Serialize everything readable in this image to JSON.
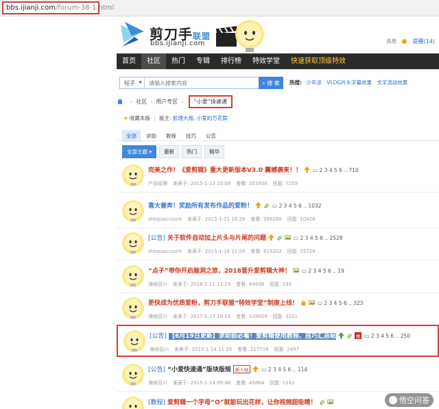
{
  "address_bar": {
    "host": "bbs.ijianji.com",
    "path": "/forum-38-1.html"
  },
  "logo": {
    "name": "剪刀手",
    "alliance": "联盟",
    "domain": "bbs.iJianJi.com"
  },
  "top_right": {
    "messages": "消息",
    "reminder": "提醒(14)"
  },
  "nav": {
    "items": [
      "首页",
      "社区",
      "热门",
      "专辑",
      "排行榜",
      "特效学堂"
    ],
    "active": "社区",
    "promo": "快速获取顶级特效"
  },
  "search": {
    "type_value": "帖子",
    "placeholder": "请输入搜索内容",
    "button": "搜 索",
    "hot_label": "热搜:",
    "hot_words": [
      "少年派",
      "VLOG片头字幕效果",
      "文字流动效果"
    ]
  },
  "breadcrumb": [
    "社区",
    "用户专区"
  ],
  "breadcrumb_current": "“小爱”快速通",
  "collect": {
    "label": "收藏本版",
    "moderator_label": "版主:",
    "moderators": "肌理大炮, 小爱的万花筒"
  },
  "tabs_primary": [
    "全部",
    "求助",
    "教程",
    "技巧",
    "公告"
  ],
  "tabs_secondary": [
    "全部主题",
    "最新",
    "热门",
    "精华"
  ],
  "threads": [
    {
      "tag": "",
      "title": "完美之作！《爱剪辑》重大更新版本V3.0 震撼袭来！！",
      "color": "#d03a1e",
      "pages": "2 3 4 5 6 .. 710",
      "author": "产品经理",
      "date": "发表于: 2015-1-13 15:09",
      "views": "查看: 351000",
      "replies": "回复: 7259"
    },
    {
      "tag": "",
      "title": "喜大普奔！奖励所有发布作品的爱粉！",
      "color": "#3b7ad1",
      "pages": "2 3 4 5 6 .. 1032",
      "author": "shequaccount",
      "date": "发表于: 2015-1-21 18:28",
      "views": "查看: 399280",
      "replies": "回复: 10428"
    },
    {
      "tag": "[公告]",
      "title": "关于软件自动加上片头与片尾的问题",
      "color": "#d03a1e",
      "pages": "2 3 4 5 6 .. 2528",
      "author": "shequaccount",
      "date": "发表于: 2015-1-18 21:54",
      "views": "查看: 819202",
      "replies": "回复: 25728"
    },
    {
      "tag": "",
      "title": "“点子”带你开启脑洞之旅，2018晋升爱剪辑大神！",
      "color": "#d03a1e",
      "pages": "2 3 4 5 6 .. 19",
      "author": "海纳百川",
      "date": "发表于: 2018-2-11 13:29",
      "views": "查看: 44938",
      "replies": "回复: 193"
    },
    {
      "tag": "",
      "title": "更快成为优质爱粉，剪刀手联盟“特效学堂”制度上线！",
      "color": "#d03a1e",
      "pages": "2 3 4 5 6 .. 323",
      "author": "海纳百川",
      "date": "发表于: 2017-5-17 16:15",
      "views": "查看: 109459",
      "replies": "回复: 3221"
    },
    {
      "tag": "[公告]",
      "title": "【6月19日更新】求助前必看！爱剪辑使用教程、技巧汇总帖",
      "color": "#d03a1e",
      "pages": "2 3 4 5 6 .. 250",
      "author": "海纳百川",
      "date": "发表于: 2015-1-14 11:26",
      "views": "查看: 217716",
      "replies": "回复: 2497"
    },
    {
      "tag": "[公告]",
      "title": "“小爱快速通”版块版规",
      "color": "#333333",
      "pages": "2 3 4 5 6 .. 114",
      "author": "海纳百川",
      "date": "发表于: 2015-1-14 09:48",
      "views": "查看: 45864",
      "replies": "回复: 1142"
    },
    {
      "tag": "[教程]",
      "title": "爱剪辑一个字母“O”就能玩出花样，让你视频超吸睛！",
      "color": "#d03a1e",
      "pages": "",
      "author": "",
      "date": "",
      "views": "",
      "replies": ""
    }
  ],
  "badges": {
    "new": "新人帖",
    "rec": "推"
  },
  "watermark": "悟空问答"
}
